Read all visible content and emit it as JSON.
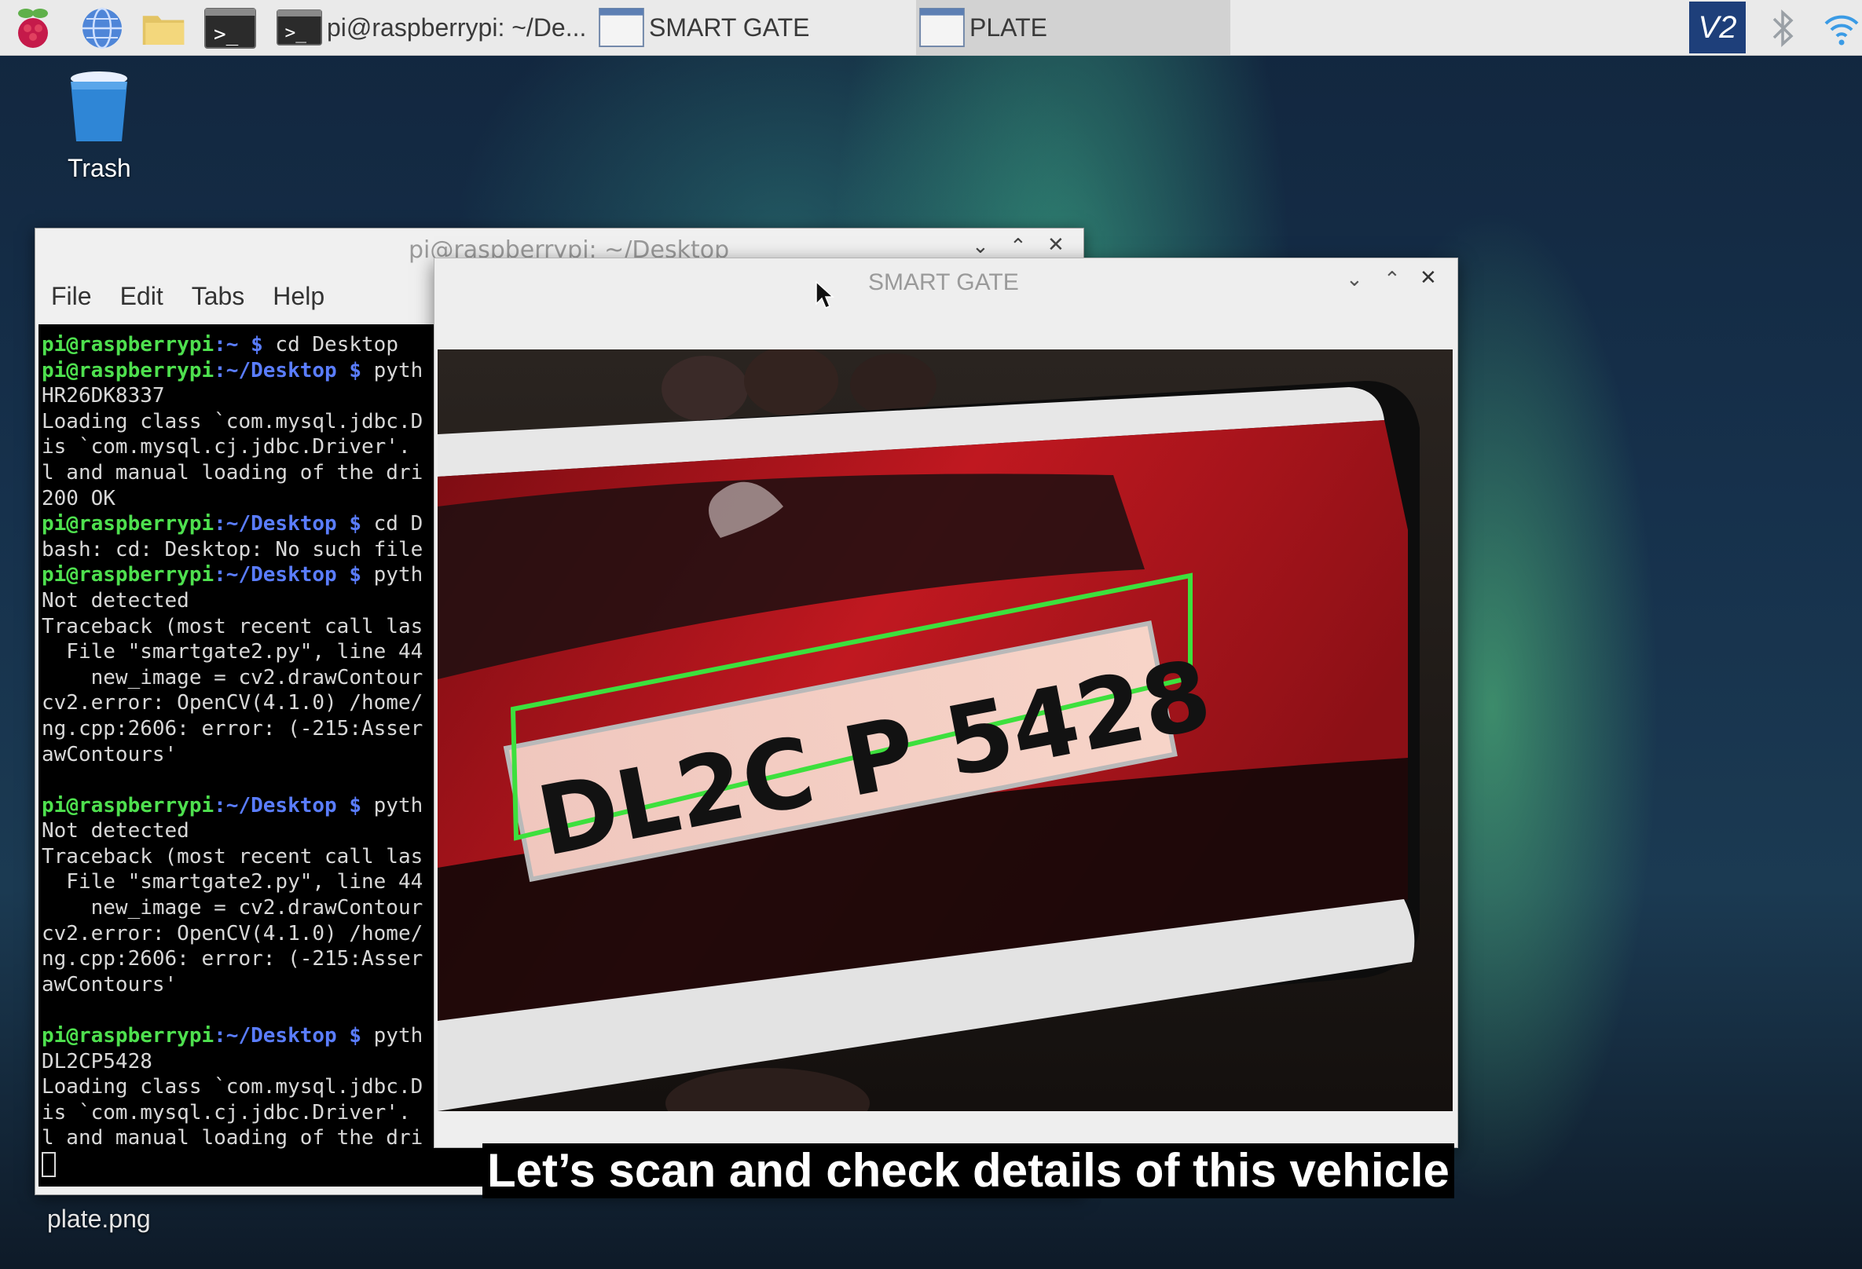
{
  "taskbar": {
    "launchers": [
      "raspberry-menu-icon",
      "web-browser-icon",
      "file-manager-icon",
      "terminal-icon"
    ],
    "tasks": [
      {
        "label": "pi@raspberrypi: ~/De...",
        "icon": "terminal-icon"
      },
      {
        "label": "SMART GATE",
        "icon": "window-icon"
      },
      {
        "label": "PLATE",
        "icon": "window-icon"
      }
    ],
    "tray": {
      "vnc_label": "V2",
      "icons": [
        "vnc-icon",
        "bluetooth-icon",
        "wifi-icon"
      ]
    }
  },
  "desktop": {
    "trash_label": "Trash",
    "file_label": "plate.png"
  },
  "terminal": {
    "title": "pi@raspberrypi: ~/Desktop",
    "menu": [
      "File",
      "Edit",
      "Tabs",
      "Help"
    ],
    "lines": [
      {
        "user": "pi@raspberrypi",
        "path": ":~ $",
        "cmd": " cd Desktop"
      },
      {
        "user": "pi@raspberrypi",
        "path": ":~/Desktop $",
        "cmd": " pyth"
      },
      {
        "text": "HR26DK8337"
      },
      {
        "text": "Loading class `com.mysql.jdbc.D"
      },
      {
        "text": "is `com.mysql.cj.jdbc.Driver'."
      },
      {
        "text": "l and manual loading of the dri"
      },
      {
        "text": "200 OK"
      },
      {
        "user": "pi@raspberrypi",
        "path": ":~/Desktop $",
        "cmd": " cd D"
      },
      {
        "text": "bash: cd: Desktop: No such file"
      },
      {
        "user": "pi@raspberrypi",
        "path": ":~/Desktop $",
        "cmd": " pyth"
      },
      {
        "text": "Not detected"
      },
      {
        "text": "Traceback (most recent call las"
      },
      {
        "text": "  File \"smartgate2.py\", line 44"
      },
      {
        "text": "    new_image = cv2.drawContour"
      },
      {
        "text": "cv2.error: OpenCV(4.1.0) /home/"
      },
      {
        "text": "ng.cpp:2606: error: (-215:Asser"
      },
      {
        "text": "awContours'"
      },
      {
        "text": ""
      },
      {
        "user": "pi@raspberrypi",
        "path": ":~/Desktop $",
        "cmd": " pyth"
      },
      {
        "text": "Not detected"
      },
      {
        "text": "Traceback (most recent call las"
      },
      {
        "text": "  File \"smartgate2.py\", line 44"
      },
      {
        "text": "    new_image = cv2.drawContour"
      },
      {
        "text": "cv2.error: OpenCV(4.1.0) /home/"
      },
      {
        "text": "ng.cpp:2606: error: (-215:Asser"
      },
      {
        "text": "awContours'"
      },
      {
        "text": ""
      },
      {
        "user": "pi@raspberrypi",
        "path": ":~/Desktop $",
        "cmd": " pyth"
      },
      {
        "text": "DL2CP5428"
      },
      {
        "text": "Loading class `com.mysql.jdbc.D"
      },
      {
        "text": "is `com.mysql.cj.jdbc.Driver'."
      },
      {
        "text": "l and manual loading of the dri"
      }
    ]
  },
  "smart_gate": {
    "title": "SMART GATE",
    "plate_text": "DL2C P 5428",
    "detection_color": "#3de03d"
  },
  "caption": "Let’s scan and check details of this vehicle",
  "colors": {
    "prompt_user": "#4ee04e",
    "prompt_path": "#5a7dff",
    "car_red": "#b0141c"
  }
}
